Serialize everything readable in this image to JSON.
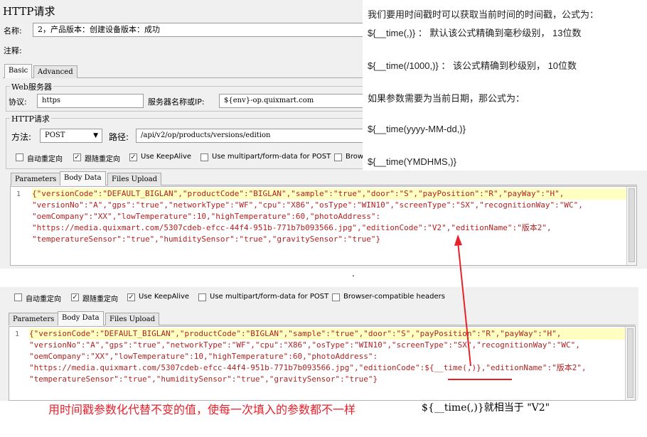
{
  "sampler": {
    "title": "HTTP请求",
    "name_label": "名称:",
    "name_value": "2，产品版本：创建设备版本：成功",
    "comment_label": "注释:",
    "tabs": [
      "Basic",
      "Advanced"
    ]
  },
  "web_server": {
    "group_label": "Web服务器",
    "protocol_label": "协议:",
    "protocol_value": "https",
    "server_label": "服务器名称或IP:",
    "server_value": "${env}-op.quixmart.com"
  },
  "http_request": {
    "group_label": "HTTP请求",
    "method_label": "方法:",
    "method_value": "POST",
    "path_label": "路径:",
    "path_value": "/api/v2/op/products/versions/edition"
  },
  "options": {
    "auto_redirect": "自动重定向",
    "follow_redirect": "跟随重定向",
    "keepalive": "Use KeepAlive",
    "multipart": "Use multipart/form-data for POST",
    "browser_compat_cut": "Brows",
    "browser_compat": "Browser-compatible headers"
  },
  "body_tabs": [
    "Parameters",
    "Body Data",
    "Files Upload"
  ],
  "body_top": {
    "line_no": "1",
    "lines": [
      "{\"versionCode\":\"DEFAULT_BIGLAN\",\"productCode\":\"BIGLAN\",\"sample\":\"true\",\"door\":\"S\",\"payPosition\":\"R\",\"payWay\":\"H\",",
      "\"versionNo\":\"A\",\"gps\":\"true\",\"networkType\":\"WF\",\"cpu\":\"X86\",\"osType\":\"WIN10\",\"screenType\":\"SX\",\"recognitionWay\":\"WC\",",
      "\"oemCompany\":\"XX\",\"lowTemperature\":10,\"highTemperature\":60,\"photoAddress\":",
      "\"https://media.quixmart.com/5307cdeb-efcc-44f4-951b-771b7b093566.jpg\",\"editionCode\":\"V2\",\"editionName\":\"版本2\",",
      "\"temperatureSensor\":\"true\",\"humiditySensor\":\"true\",\"gravitySensor\":\"true\"}"
    ]
  },
  "body_bottom": {
    "line_no": "1",
    "lines": [
      "{\"versionCode\":\"DEFAULT_BIGLAN\",\"productCode\":\"BIGLAN\",\"sample\":\"true\",\"door\":\"S\",\"payPosition\":\"R\",\"payWay\":\"H\",",
      "\"versionNo\":\"A\",\"gps\":\"true\",\"networkType\":\"WF\",\"cpu\":\"X86\",\"osType\":\"WIN10\",\"screenType\":\"SX\",\"recognitionWay\":\"WC\",",
      "\"oemCompany\":\"XX\",\"lowTemperature\":10,\"highTemperature\":60,\"photoAddress\":",
      "\"https://media.quixmart.com/5307cdeb-efcc-44f4-951b-771b7b093566.jpg\",\"editionCode\":${__time(,)},\"editionName\":\"版本2\",",
      "\"temperatureSensor\":\"true\",\"humiditySensor\":\"true\",\"gravitySensor\":\"true\"}"
    ]
  },
  "note": {
    "line1": "我们要用时间戳时可以获取当前时间的时间戳，公式为：",
    "line2": "${__time(,)} ： 默认该公式精确到毫秒级别， 13位数",
    "line3": "${__time(/1000,)} ： 该公式精确到秒级别， 10位数",
    "line4": "如果参数需要为当前日期，那公式为：",
    "line5": "${__time(yyyy-MM-dd,)}",
    "line6": "${__time(YMDHMS,)}"
  },
  "annotation": {
    "caption": "用时间戳参数化代替不变的值，使每一次填入的参数都不一样",
    "equiv": "${__time(,)}就相当于 \"V2\"",
    "dot": ".",
    "arrow_color": "#e8202a",
    "caption_color": "#e8202a"
  }
}
